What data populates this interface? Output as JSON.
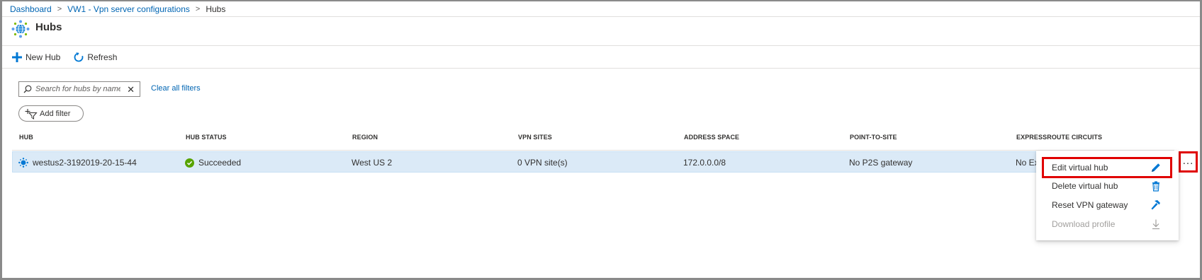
{
  "breadcrumb": {
    "items": [
      "Dashboard",
      "VW1 - Vpn server configurations"
    ],
    "current": "Hubs",
    "separator": ">"
  },
  "page": {
    "title": "Hubs",
    "icon": "virtual-hub-icon"
  },
  "toolbar": {
    "new_hub_label": "New Hub",
    "refresh_label": "Refresh"
  },
  "filters": {
    "search_placeholder": "Search for hubs by name",
    "search_value": "",
    "clear_all_label": "Clear all filters",
    "add_filter_label": "Add filter"
  },
  "table": {
    "columns": [
      "HUB",
      "HUB STATUS",
      "REGION",
      "VPN SITES",
      "ADDRESS SPACE",
      "POINT-TO-SITE",
      "EXPRESSROUTE CIRCUITS"
    ],
    "rows": [
      {
        "hub": "westus2-3192019-20-15-44",
        "status": "Succeeded",
        "region": "West US 2",
        "vpn_sites": "0 VPN site(s)",
        "address_space": "172.0.0.0/8",
        "point_to_site": "No P2S gateway",
        "expressroute": "No Ex"
      }
    ]
  },
  "row_menu": {
    "more_label": "...",
    "items": [
      {
        "label": "Edit virtual hub",
        "icon": "pencil-icon",
        "enabled": true,
        "highlighted": true
      },
      {
        "label": "Delete virtual hub",
        "icon": "trash-icon",
        "enabled": true
      },
      {
        "label": "Reset VPN gateway",
        "icon": "hammer-icon",
        "enabled": true
      },
      {
        "label": "Download profile",
        "icon": "download-icon",
        "enabled": false
      }
    ]
  },
  "colors": {
    "link": "#0065b3",
    "accent": "#0078d4",
    "selected_row": "#dbeaf7",
    "success": "#57a300",
    "highlight_box": "#e00000",
    "disabled_text": "#a19f9d"
  }
}
